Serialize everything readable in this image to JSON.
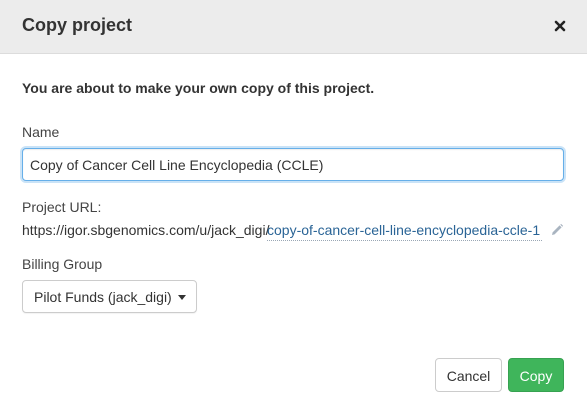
{
  "dialog": {
    "title": "Copy project",
    "close_icon": "close-icon",
    "intro_text": "You are about to make your own copy of this project."
  },
  "name_field": {
    "label": "Name",
    "value": "Copy of Cancer Cell Line Encyclopedia (CCLE)"
  },
  "project_url": {
    "label": "Project URL:",
    "prefix": "https://igor.sbgenomics.com/u/jack_digi/",
    "slug": "copy-of-cancer-cell-line-encyclopedia-ccle-1",
    "edit_icon": "pencil-icon"
  },
  "billing_group": {
    "label": "Billing Group",
    "selected": "Pilot Funds (jack_digi)",
    "caret_icon": "caret-down-icon"
  },
  "footer": {
    "cancel_label": "Cancel",
    "copy_label": "Copy"
  },
  "colors": {
    "header_bg": "#ececec",
    "primary_green": "#3fb55b",
    "link_blue": "#2a6496",
    "focus_blue": "#66afe9"
  }
}
